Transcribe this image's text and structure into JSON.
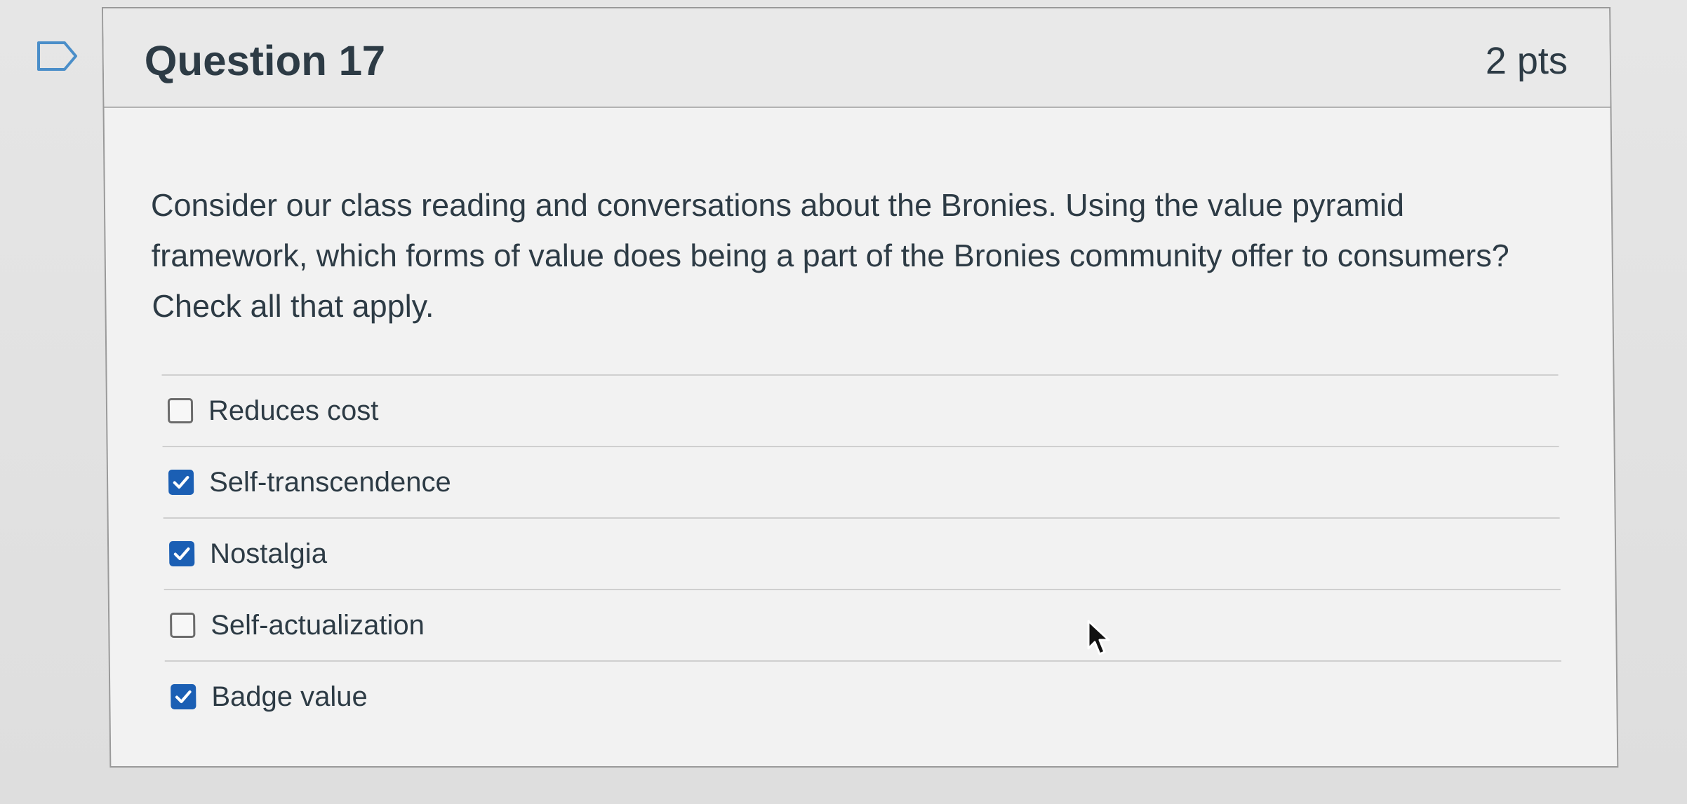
{
  "question": {
    "title": "Question 17",
    "points": "2 pts",
    "text": "Consider our class reading and conversations about the Bronies. Using the value pyramid framework, which forms of value does being a part of the Bronies community offer to consumers? Check all that apply.",
    "flag_icon": "flag-icon"
  },
  "answers": [
    {
      "label": "Reduces cost",
      "checked": false
    },
    {
      "label": "Self-transcendence",
      "checked": true
    },
    {
      "label": "Nostalgia",
      "checked": true
    },
    {
      "label": "Self-actualization",
      "checked": false
    },
    {
      "label": "Badge value",
      "checked": true
    }
  ],
  "colors": {
    "checkbox_checked": "#1b5fb4",
    "text": "#2d3b45"
  }
}
